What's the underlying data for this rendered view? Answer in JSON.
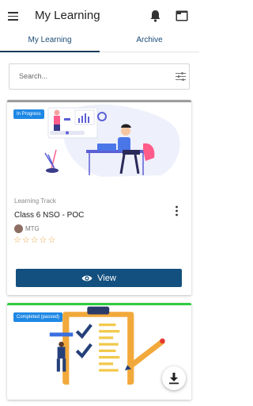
{
  "header": {
    "title": "My Learning"
  },
  "tabs": [
    {
      "label": "My Learning",
      "active": true
    },
    {
      "label": "Archive",
      "active": false
    }
  ],
  "search": {
    "placeholder": "Search..."
  },
  "cards": [
    {
      "badge": "In Progress",
      "type": "Learning Track",
      "title": "Class 6 NSO - POC",
      "author": "MTG",
      "rating": 0,
      "action_label": "View",
      "status_color": "#9e9e9e"
    },
    {
      "badge": "Completed (passed)",
      "status_color": "#2ecc40"
    }
  ],
  "icons": [
    "menu-icon",
    "bell-icon",
    "folder-icon",
    "filter-icon",
    "more-vert-icon",
    "eye-icon",
    "download-icon"
  ],
  "colors": {
    "primary": "#14507f",
    "badge": "#1e88e5",
    "star": "#e6a23c"
  }
}
